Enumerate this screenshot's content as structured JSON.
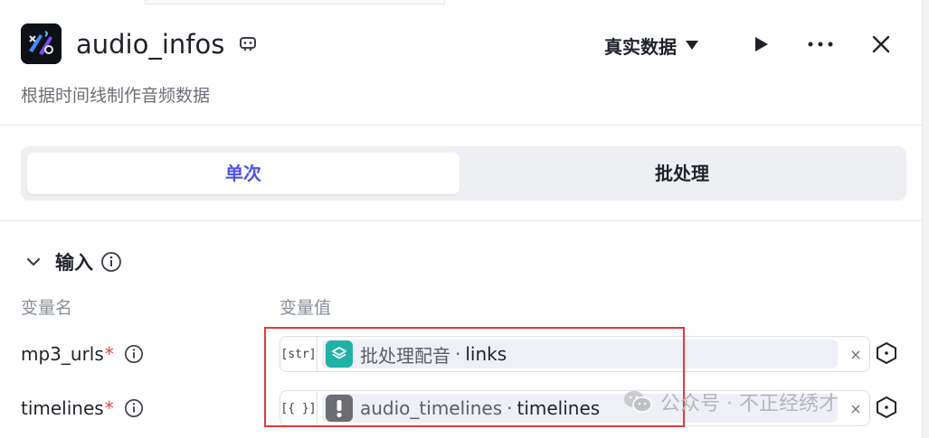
{
  "node": {
    "title": "audio_infos",
    "description": "根据时间线制作音频数据",
    "icon": "audio-clip-icon",
    "badge_icon": "plugin-badge-icon"
  },
  "toolbar": {
    "mode_label": "真实数据",
    "mode_icon": "caret-down-icon",
    "run_icon": "play-icon",
    "more_icon": "more-horizontal-icon",
    "close_icon": "close-icon"
  },
  "tabs": [
    {
      "label": "单次",
      "active": true
    },
    {
      "label": "批处理",
      "active": false
    }
  ],
  "inputs": {
    "section_title": "输入",
    "col_name": "变量名",
    "col_value": "变量值",
    "rows": [
      {
        "name": "mp3_urls",
        "required_mark": "*",
        "type_tag": "[str]",
        "ref_icon": "layers-icon",
        "ref_node": "批处理配音",
        "separator": "·",
        "ref_key": "links",
        "clear": "×"
      },
      {
        "name": "timelines",
        "required_mark": "*",
        "type_tag": "[{ }]",
        "ref_icon": "exclamation-icon",
        "ref_node": "audio_timelines",
        "separator": "·",
        "ref_key": "timelines",
        "clear": "×"
      }
    ]
  },
  "watermark": {
    "icon": "wechat-icon",
    "text": "公众号 · 不正经绣才"
  },
  "colors": {
    "accent": "#4d53e8",
    "required": "#e54545",
    "highlight": "#e33a3a",
    "teal": "#21b2a6"
  }
}
